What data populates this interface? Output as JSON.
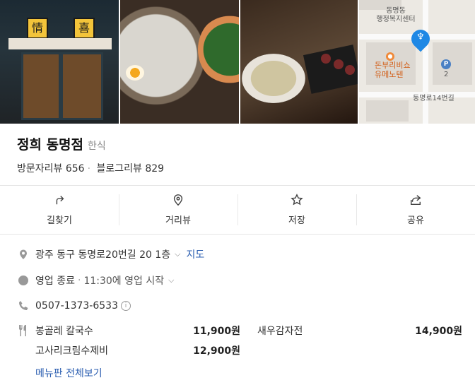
{
  "photos": {
    "storefront_sign_left": "情",
    "storefront_sign_right": "喜",
    "map": {
      "district_label": "동명동\n행정복지센터",
      "poi_label": "돈부리비쇼\n유메노텐",
      "street_label": "동명로14번길",
      "parking_label": "P",
      "parking_sub": "2"
    }
  },
  "place": {
    "name": "정희 동명점",
    "category": "한식",
    "visitor_reviews": "방문자리뷰 656",
    "blog_reviews": "블로그리뷰 829"
  },
  "actions": [
    {
      "label": "길찾기",
      "icon": "directions-icon"
    },
    {
      "label": "거리뷰",
      "icon": "location-pin-icon"
    },
    {
      "label": "저장",
      "icon": "star-icon"
    },
    {
      "label": "공유",
      "icon": "share-icon"
    }
  ],
  "info": {
    "address": "광주 동구 동명로20번길 20 1층",
    "map_link": "지도",
    "status": "영업 종료",
    "status_detail": "11:30에 영업 시작",
    "phone": "0507-1373-6533",
    "info_mark": "i"
  },
  "menu": {
    "items": [
      {
        "name": "봉골레 칼국수",
        "price": "11,900원"
      },
      {
        "name": "새우감자전",
        "price": "14,900원"
      },
      {
        "name": "고사리크림수제비",
        "price": "12,900원"
      }
    ],
    "view_all": "메뉴판 전체보기"
  },
  "colors": {
    "link": "#2a5db0",
    "pin": "#1e88e5",
    "poi": "#d2601a"
  }
}
